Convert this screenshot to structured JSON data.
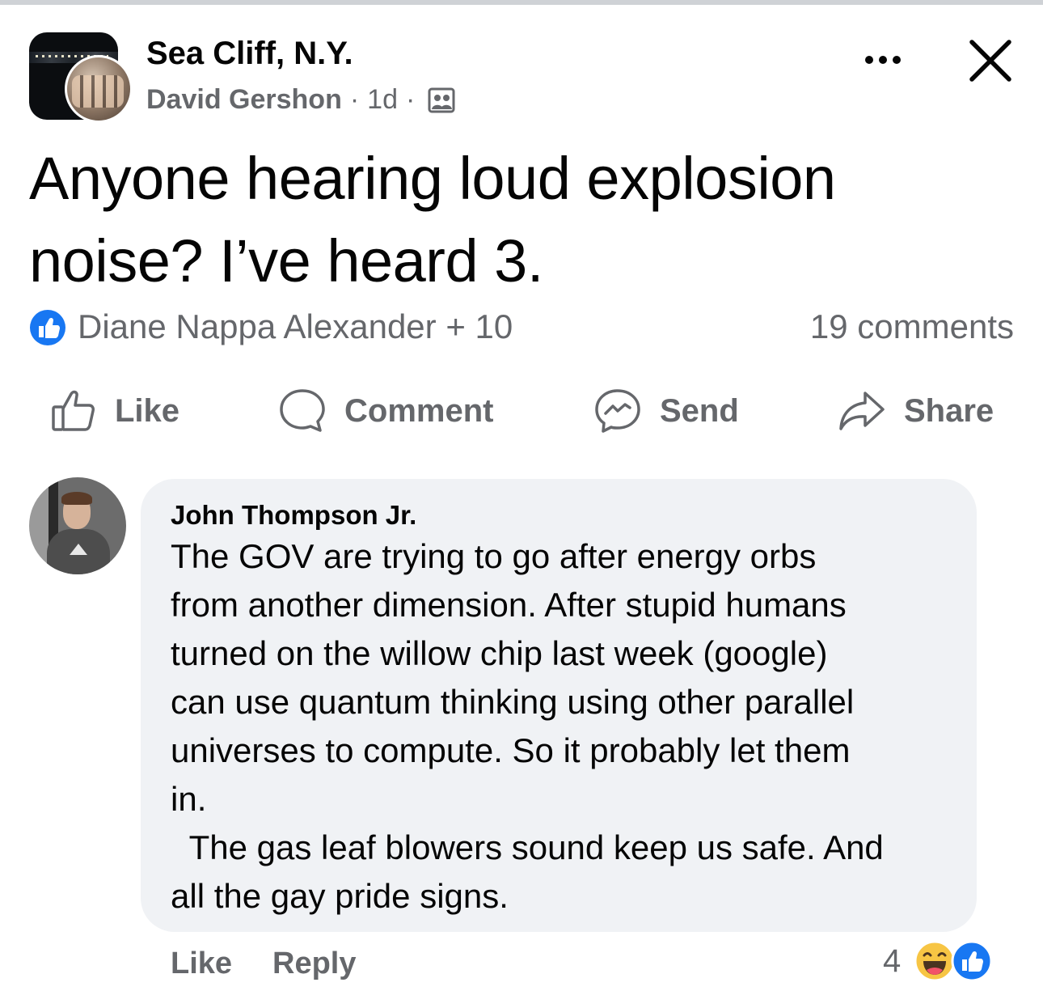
{
  "post": {
    "group_name": "Sea Cliff, N.Y.",
    "author": "David Gershon",
    "separator": "·",
    "time": "1d",
    "audience_icon": "group-audience-icon",
    "text_lines": [
      "Anyone hearing loud explosion",
      "noise? I’ve heard 3."
    ],
    "reactors": "Diane Nappa Alexander + 10",
    "comments_count": "19 comments"
  },
  "actions": {
    "like": "Like",
    "comment": "Comment",
    "send": "Send",
    "share": "Share"
  },
  "comment": {
    "author": "John Thompson Jr.",
    "lines": [
      "The GOV are trying to go after energy orbs",
      "from another dimension. After stupid humans",
      "turned on the willow chip last week (google)",
      "can use quantum thinking using other parallel",
      "universes to compute. So it probably let them",
      "in.",
      "  The gas leaf blowers sound keep us safe. And",
      "all the gay pride signs."
    ],
    "like_label": "Like",
    "reply_label": "Reply",
    "reaction_count": "4"
  },
  "colors": {
    "text": "#050505",
    "secondary": "#65676b",
    "bubble": "#f0f2f5",
    "like_blue": "#1877f2",
    "haha_yellow": "#f7c544"
  }
}
